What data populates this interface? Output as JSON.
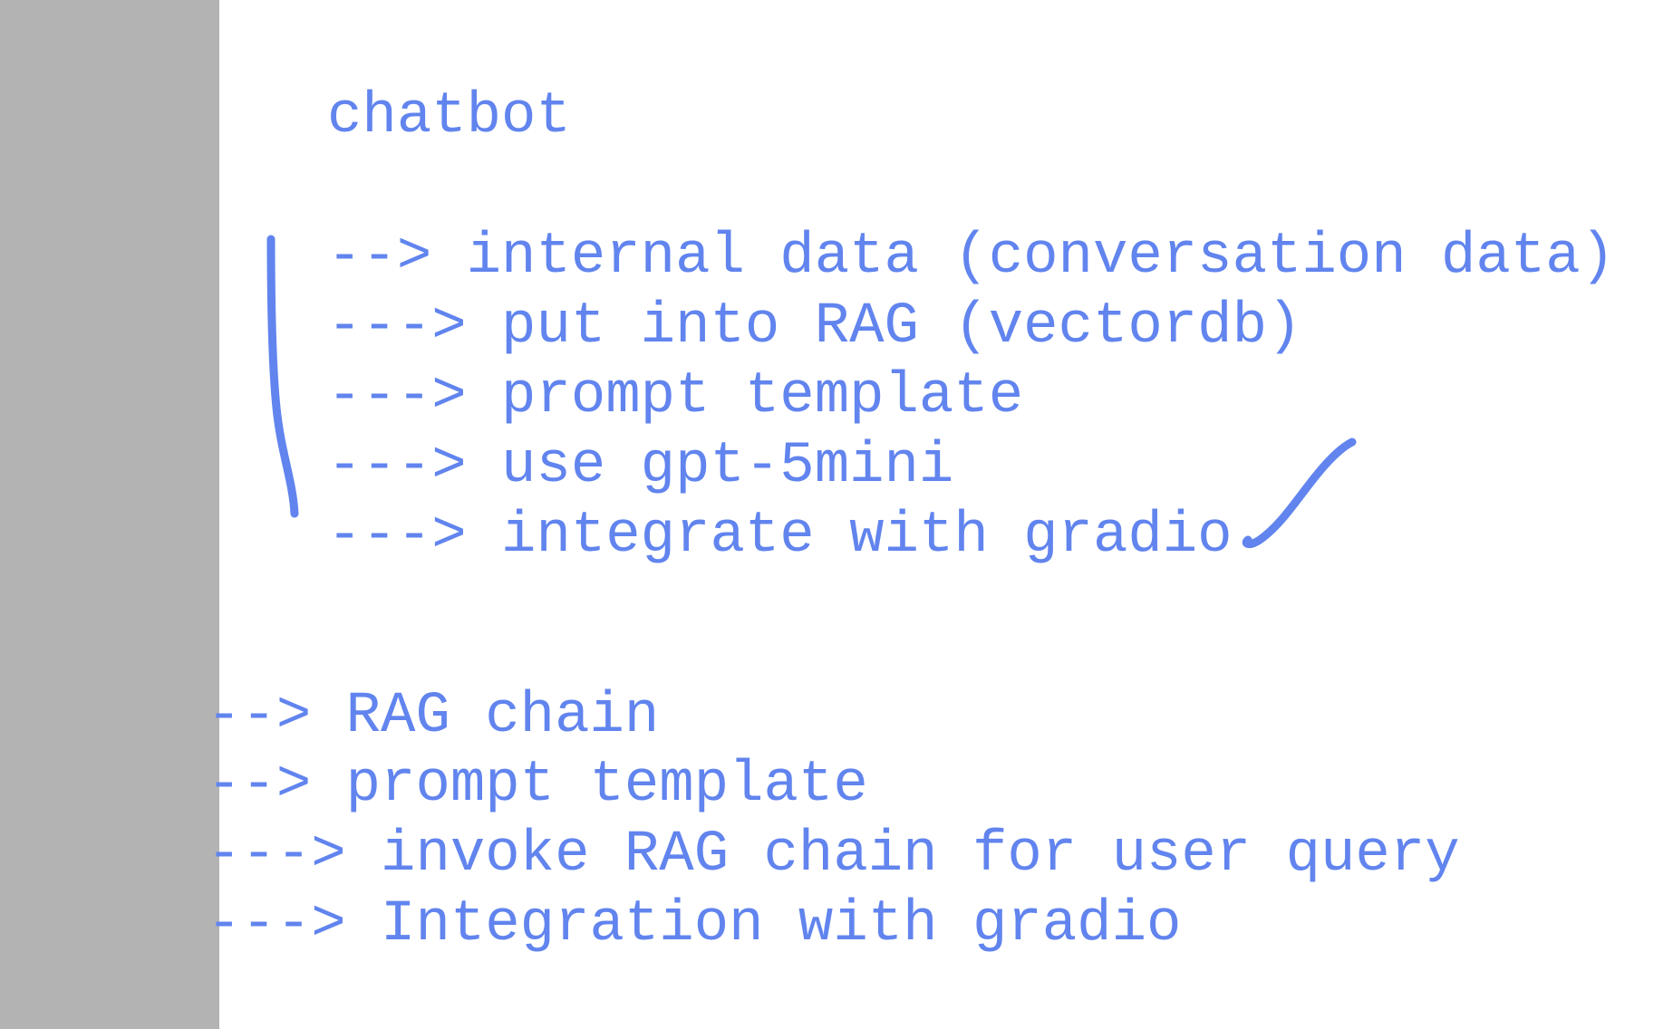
{
  "color": "#6184ee",
  "title": "chatbot",
  "plan": [
    "--> internal data (conversation data)",
    "---> put into RAG (vectordb)",
    "---> prompt template",
    "---> use gpt-5mini",
    "---> integrate with gradio"
  ],
  "steps": [
    "--> RAG chain",
    "--> prompt template",
    "---> invoke RAG chain for user query",
    "---> Integration with gradio"
  ]
}
